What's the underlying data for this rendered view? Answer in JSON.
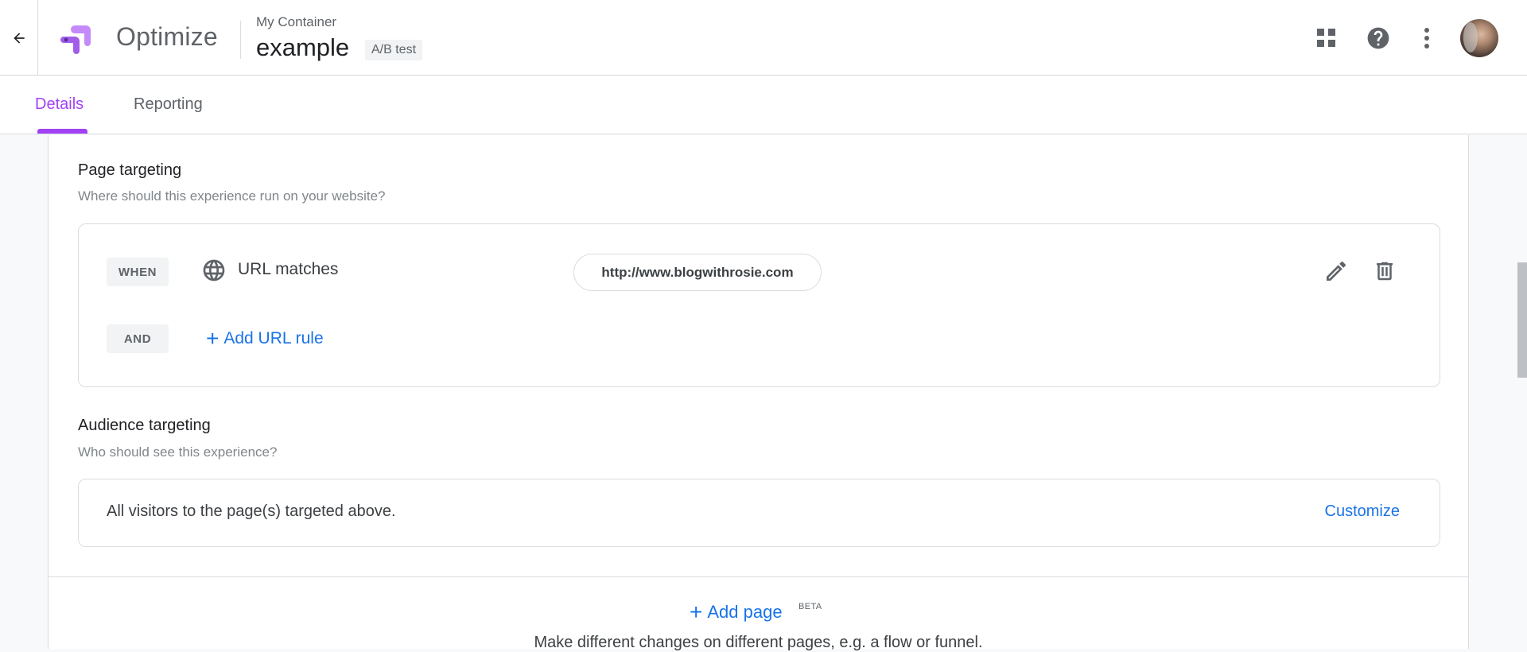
{
  "header": {
    "back_icon": "arrow-back-icon",
    "app_name": "Optimize",
    "container_name": "My Container",
    "experiment_name": "example",
    "experiment_type": "A/B test",
    "icons": [
      "apps-grid-icon",
      "help-icon",
      "more-vert-icon",
      "avatar"
    ]
  },
  "tabs": [
    {
      "label": "Details",
      "active": true
    },
    {
      "label": "Reporting",
      "active": false
    }
  ],
  "page_targeting": {
    "title": "Page targeting",
    "subtitle": "Where should this experience run on your website?",
    "rules": [
      {
        "operator": "WHEN",
        "icon": "globe-icon",
        "label": "URL matches",
        "value": "http://www.blogwithrosie.com"
      }
    ],
    "and_label": "AND",
    "add_rule_label": "Add URL rule"
  },
  "audience_targeting": {
    "title": "Audience targeting",
    "subtitle": "Who should see this experience?",
    "description": "All visitors to the page(s) targeted above.",
    "customize_label": "Customize"
  },
  "add_page": {
    "label": "Add page",
    "badge": "BETA",
    "description": "Make different changes on different pages, e.g. a flow or funnel."
  },
  "colors": {
    "accent_purple": "#a142f4",
    "link_blue": "#1a73e8",
    "border": "#dadce0"
  }
}
